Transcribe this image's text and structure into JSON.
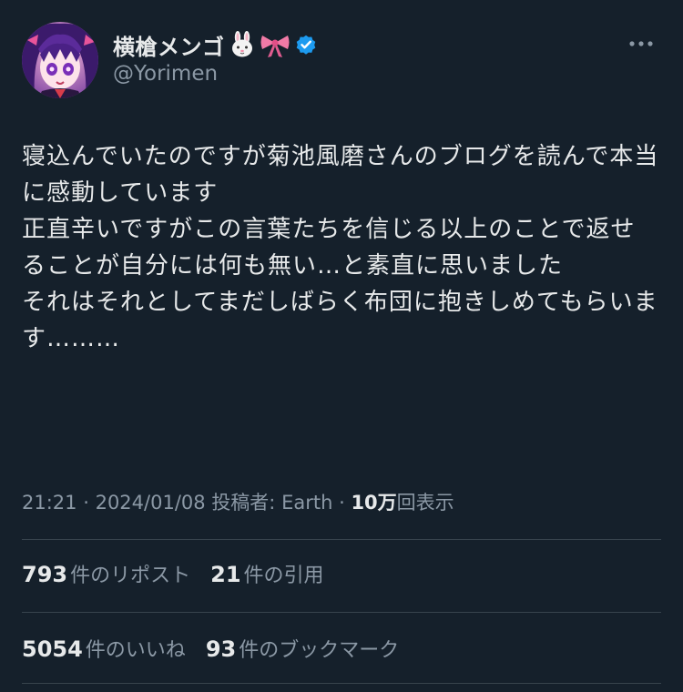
{
  "colors": {
    "background": "#15202b",
    "text_primary": "#e7e9ea",
    "text_secondary": "#8b98a5",
    "divider": "#38444d",
    "verified_badge": "#1d9bf0"
  },
  "author": {
    "display_name": "横槍メンゴ",
    "emoji": [
      "rabbit-face-icon",
      "ribbon-icon"
    ],
    "verified_icon": "verified-badge-icon",
    "handle": "@Yorimen",
    "more_icon": "more-options-icon"
  },
  "tweet": {
    "text": "寝込んでいたのですが菊池風磨さんのブログを読んで本当に感動しています\n正直辛いですがこの言葉たちを信じる以上のことで返せることが自分には何も無い…と素直に思いました\nそれはそれとしてまだしばらく布団に抱きしめてもらいます………"
  },
  "meta": {
    "time": "21:21",
    "date": "2024/01/08",
    "source_label": "投稿者: Earth",
    "views_count": "10万",
    "views_label": "回表示"
  },
  "stats": {
    "reposts_count": "793",
    "reposts_label": "件のリポスト",
    "quotes_count": "21",
    "quotes_label": "件の引用",
    "likes_count": "5054",
    "likes_label": "件のいいね",
    "bookmarks_count": "93",
    "bookmarks_label": "件のブックマーク"
  }
}
